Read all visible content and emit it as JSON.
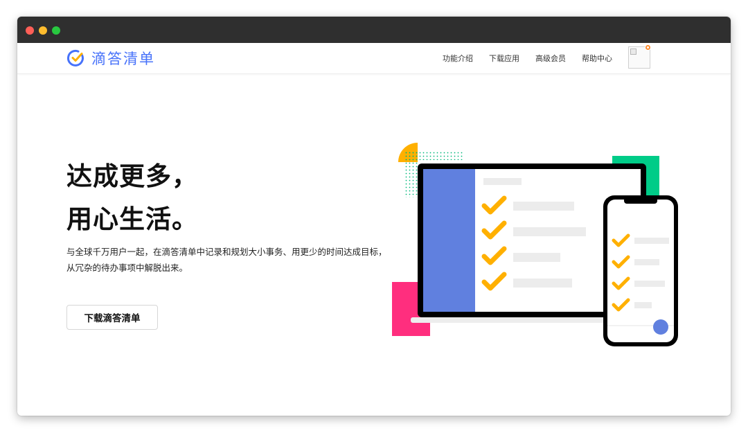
{
  "brand": {
    "name": "滴答清单",
    "color": "#4772fa",
    "check_color": "#ffb000"
  },
  "nav": {
    "items": [
      {
        "label": "功能介绍"
      },
      {
        "label": "下载应用"
      },
      {
        "label": "高级会员"
      },
      {
        "label": "帮助中心"
      }
    ]
  },
  "hero": {
    "title_line1": "达成更多，",
    "title_line2": "用心生活。",
    "description": "与全球千万用户一起，在滴答清单中记录和规划大小事务、用更少的时间达成目标，从冗杂的待办事项中解脱出来。",
    "cta_label": "下载滴答清单"
  },
  "illustration": {
    "laptop_sidebar_color": "#6080df",
    "pink_accent": "#ff2e7e",
    "green_accent": "#00cc88",
    "yellow_accent": "#ffb000",
    "button_dot_color": "#6080df",
    "laptop_checked_tasks": 4,
    "phone_checked_tasks": 4
  }
}
